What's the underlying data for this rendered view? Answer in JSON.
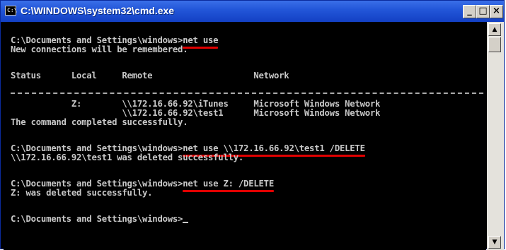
{
  "window": {
    "title": "C:\\WINDOWS\\system32\\cmd.exe",
    "icon_text": "C:\\",
    "buttons": {
      "minimize": "_",
      "maximize": "□",
      "close": "×"
    }
  },
  "console": {
    "l1_prompt": "C:\\Documents and Settings\\windows>",
    "l1_cmd": "net use",
    "l2": "New connections will be remembered.",
    "header": "Status      Local     Remote                    Network",
    "row1": "            Z:        \\\\172.16.66.92\\iTunes     Microsoft Windows Network",
    "row2": "                      \\\\172.16.66.92\\test1      Microsoft Windows Network",
    "row3": "The command completed successfully.",
    "l4_prompt": "C:\\Documents and Settings\\windows>",
    "l4_cmd": "net use \\\\172.16.66.92\\test1 /DELETE",
    "l5": "\\\\172.16.66.92\\test1 was deleted successfully.",
    "l6_prompt": "C:\\Documents and Settings\\windows>",
    "l6_cmd": "net use Z: /DELETE",
    "l7": "Z: was deleted successfully.",
    "l8_prompt": "C:\\Documents and Settings\\windows>"
  },
  "scrollbar": {
    "up_arrow": "▲",
    "down_arrow": "▼"
  },
  "colors": {
    "console_bg": "#000000",
    "console_text": "#c8c8c8",
    "underline": "#e00000",
    "titlebar": "#2357d9"
  }
}
